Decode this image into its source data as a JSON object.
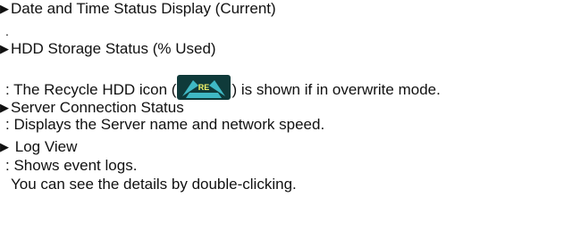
{
  "items": [
    {
      "label": "Date and Time Status Display (Current)"
    },
    {
      "label": "HDD Storage Status (% Used)",
      "note_before_icon": ": The Recycle HDD icon (",
      "note_after_icon": ") is shown if in overwrite mode.",
      "icon": {
        "name": "recycle-hdd-icon",
        "text": "RE",
        "color_bg": "#0f3a3a",
        "color_arrows": "#3fb8c4",
        "color_text": "#f4f56a"
      }
    },
    {
      "label": "Server Connection Status",
      "note": ": Displays the Server name and network speed."
    },
    {
      "label": "Log View",
      "note": ": Shows event logs.",
      "note2": "You can see the details by double-clicking."
    }
  ],
  "dot": "."
}
